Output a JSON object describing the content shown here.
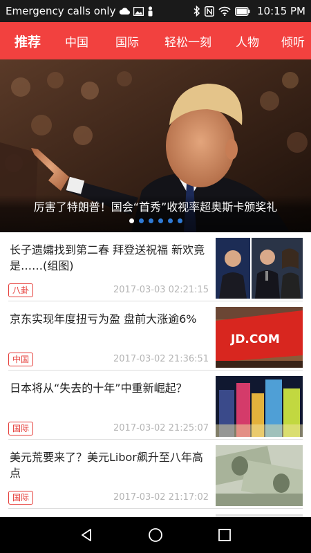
{
  "status_bar": {
    "carrier": "Emergency calls only",
    "time": "10:15 PM",
    "icons": [
      "cloud-icon",
      "image-icon",
      "person-icon",
      "bluetooth-icon",
      "nfc-icon",
      "wifi-icon",
      "battery-icon"
    ]
  },
  "tabs": [
    {
      "label": "推荐",
      "active": true
    },
    {
      "label": "中国",
      "active": false
    },
    {
      "label": "国际",
      "active": false
    },
    {
      "label": "轻松一刻",
      "active": false
    },
    {
      "label": "人物",
      "active": false
    },
    {
      "label": "倾听",
      "active": false
    }
  ],
  "banner": {
    "caption": "厉害了特朗普！国会“首秀”收视率超奥斯卡颁奖礼",
    "dot_count": 6,
    "active_dot": 0
  },
  "news": [
    {
      "title": "长子遗孀找到第二春 拜登送祝福 新欢竟是……(组图)",
      "tag": "八卦",
      "time": "2017-03-03 02:21:15"
    },
    {
      "title": "京东实现年度扭亏为盈 盘前大涨逾6%",
      "tag": "中国",
      "time": "2017-03-02 21:36:51",
      "thumb_text": "JD.COM"
    },
    {
      "title": "日本将从“失去的十年”中重新崛起？",
      "tag": "国际",
      "time": "2017-03-02 21:25:07"
    },
    {
      "title": "美元荒要来了？美元Libor飙升至八年高点",
      "tag": "国际",
      "time": "2017-03-02 21:17:02"
    }
  ],
  "colors": {
    "accent": "#f2413f",
    "tag": "#e53935",
    "dot_inactive": "#2f7bd6"
  }
}
